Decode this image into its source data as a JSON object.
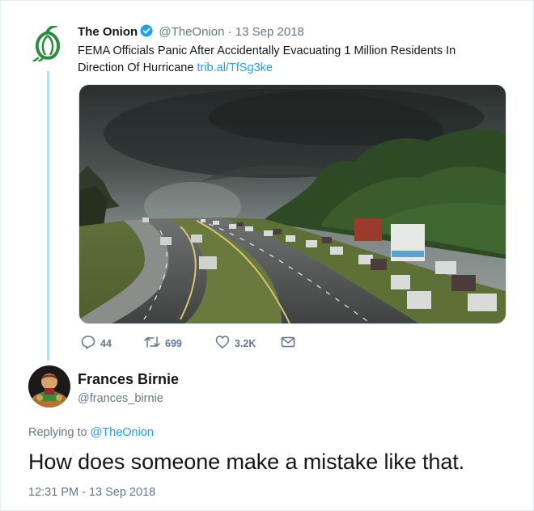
{
  "tweet1": {
    "display_name": "The Onion",
    "handle": "@TheOnion",
    "separator": "·",
    "date": "13 Sep 2018",
    "text": "FEMA Officials Panic After Accidentally Evacuating 1 Million Residents In Direction Of Hurricane",
    "link_text": "trib.al/TfSg3ke",
    "logo_icon": "onion-logo-icon",
    "media_description_icon": "hurricane-highway-photo",
    "actions": {
      "reply_count": "44",
      "retweet_count": "699",
      "like_count": "3.2K"
    }
  },
  "tweet2": {
    "display_name": "Frances Birnie",
    "handle": "@frances_birnie",
    "replying_prefix": "Replying to",
    "replying_to": "@TheOnion",
    "text": "How does someone make a mistake like that.",
    "timestamp": "12:31 PM - 13 Sep 2018"
  },
  "colors": {
    "link": "#1da1f2",
    "muted": "#657786",
    "text": "#14171a",
    "onion_green": "#2a8c3c",
    "thread_line": "#b3e0f7",
    "verified": "#1da1f2"
  }
}
